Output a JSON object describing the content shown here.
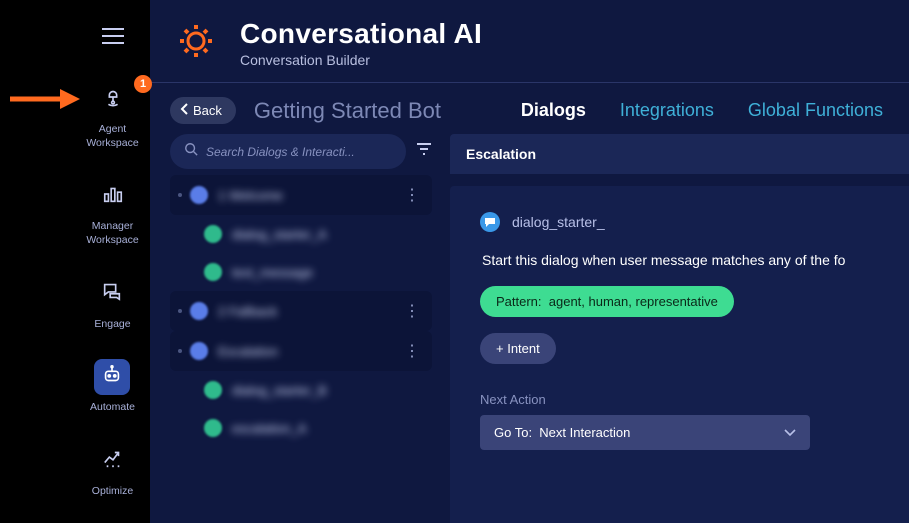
{
  "annotation": {
    "badge_count": "1"
  },
  "nav": {
    "items": [
      {
        "label": "Agent Workspace"
      },
      {
        "label": "Manager Workspace"
      },
      {
        "label": "Engage"
      },
      {
        "label": "Automate"
      },
      {
        "label": "Optimize"
      }
    ]
  },
  "header": {
    "title": "Conversational AI",
    "subtitle": "Conversation Builder"
  },
  "toolbar": {
    "back_label": "Back",
    "bot_name": "Getting Started Bot",
    "tabs": [
      {
        "label": "Dialogs"
      },
      {
        "label": "Integrations"
      },
      {
        "label": "Global Functions"
      }
    ]
  },
  "search": {
    "placeholder": "Search Dialogs & Interacti..."
  },
  "dialog_list": {
    "items": [
      {
        "label": "1 Welcome",
        "icon": "blue",
        "top": true
      },
      {
        "label": "dialog_starter_A",
        "icon": "teal",
        "indent": true
      },
      {
        "label": "text_message",
        "icon": "teal",
        "indent": true
      },
      {
        "label": "2 Fallback",
        "icon": "blue",
        "top": true
      },
      {
        "label": "Escalation",
        "icon": "blue",
        "top": true
      },
      {
        "label": "dialog_starter_B",
        "icon": "teal",
        "indent": true
      },
      {
        "label": "escalation_A",
        "icon": "teal",
        "indent": true
      }
    ]
  },
  "canvas": {
    "header": "Escalation",
    "starter": {
      "name": "dialog_starter_",
      "prompt": "Start this dialog when user message matches any of the fo",
      "pattern_label": "Pattern:",
      "pattern_value": "agent, human, representative",
      "add_intent": "+ Intent",
      "next_action_label": "Next Action",
      "next_action_value_label": "Go To:",
      "next_action_value": "Next Interaction"
    }
  }
}
